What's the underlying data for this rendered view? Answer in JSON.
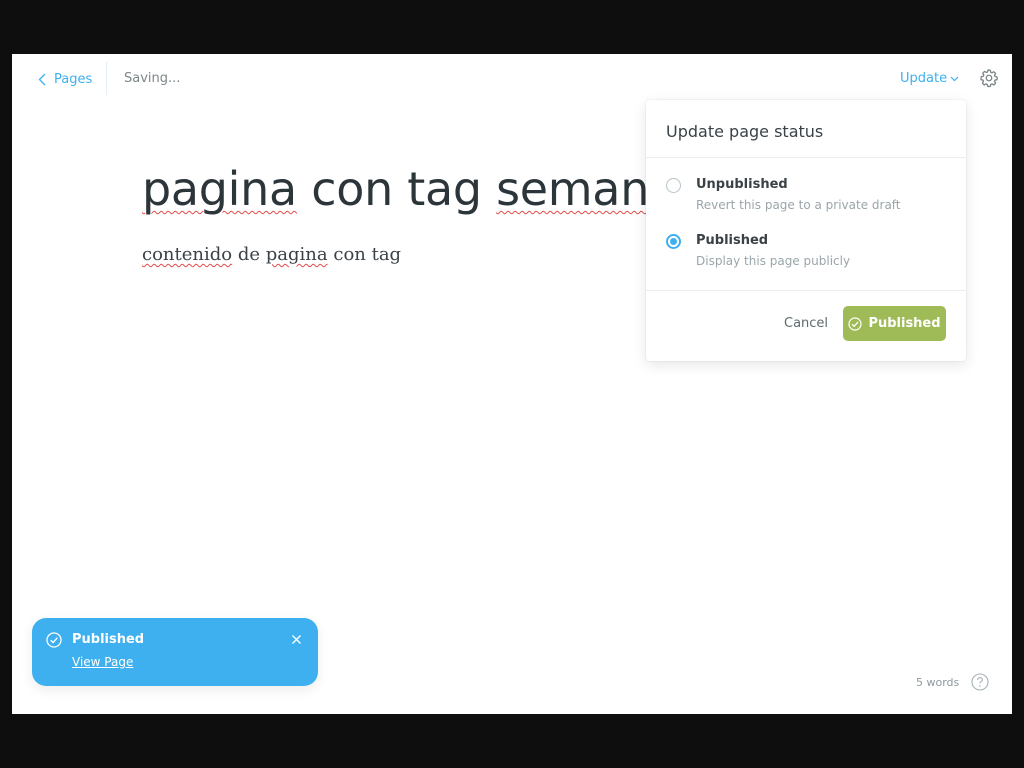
{
  "header": {
    "back_label": "Pages",
    "save_status": "Saving...",
    "update_label": "Update"
  },
  "content": {
    "title_words": [
      "pagina",
      "con tag",
      "semana"
    ],
    "body_words": [
      "contenido",
      "de",
      "pagina",
      "con tag"
    ]
  },
  "popover": {
    "title": "Update page status",
    "options": [
      {
        "label": "Unpublished",
        "description": "Revert this page to a private draft",
        "selected": false
      },
      {
        "label": "Published",
        "description": "Display this page publicly",
        "selected": true
      }
    ],
    "cancel_label": "Cancel",
    "confirm_label": "Published"
  },
  "toast": {
    "title": "Published",
    "link_label": "View Page"
  },
  "footer": {
    "word_count": "5 words"
  },
  "colors": {
    "accent": "#3eb0ef",
    "publish_green": "#9fbb58",
    "text": "#2c353a"
  },
  "icons": [
    "chevron-left-icon",
    "chevron-down-icon",
    "gear-icon",
    "check-circle-icon",
    "close-icon",
    "question-icon"
  ]
}
